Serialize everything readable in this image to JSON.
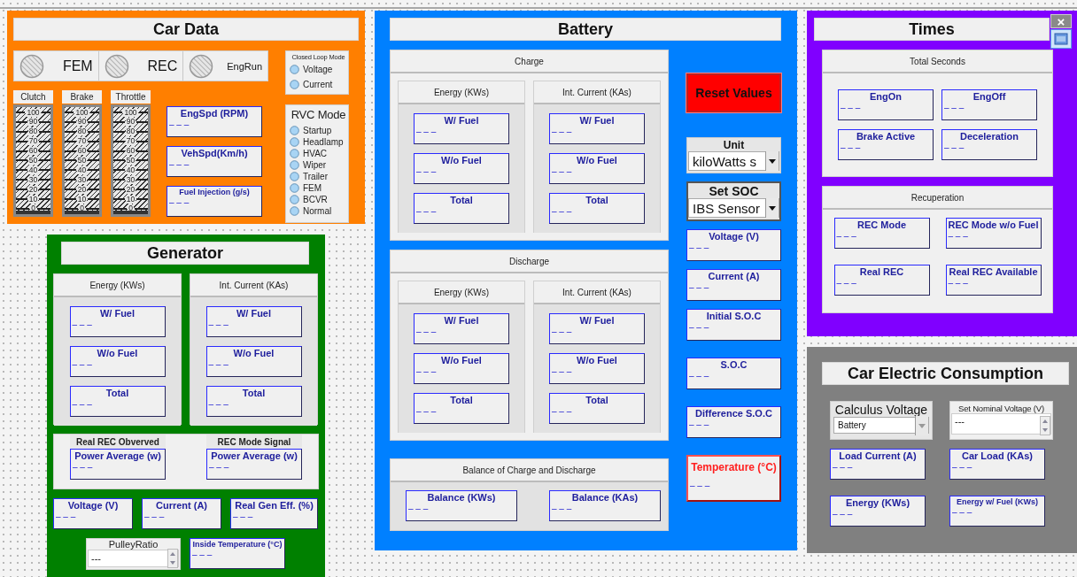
{
  "car_data": {
    "title": "Car Data",
    "leds": [
      {
        "label": "FEM",
        "on": false
      },
      {
        "label": "REC",
        "on": false
      },
      {
        "label": "EngRun",
        "on": false
      }
    ],
    "closed_loop_mode": {
      "title": "Closed Loop Mode",
      "options": [
        {
          "label": "Voltage",
          "selected": false
        },
        {
          "label": "Current",
          "selected": false
        }
      ]
    },
    "sliders": [
      {
        "label": "Clutch",
        "level": 0,
        "scale": [
          "100",
          "90",
          "80",
          "70",
          "60",
          "50",
          "40",
          "30",
          "20",
          "10",
          "0"
        ]
      },
      {
        "label": "Brake",
        "level": 0,
        "scale": [
          "100",
          "90",
          "80",
          "70",
          "60",
          "50",
          "40",
          "30",
          "20",
          "10",
          "0"
        ]
      },
      {
        "label": "Throttle",
        "level": 0,
        "scale": [
          "100",
          "90",
          "80",
          "70",
          "60",
          "50",
          "40",
          "30",
          "20",
          "10",
          "0"
        ]
      }
    ],
    "displays": [
      {
        "title": "EngSpd (RPM)",
        "value": "– – –"
      },
      {
        "title": "VehSpd(Km/h)",
        "value": "– – –"
      },
      {
        "title": "Fuel Injection (g/s)",
        "value": "– – –"
      }
    ],
    "rvc_mode": {
      "title": "RVC Mode",
      "options": [
        {
          "label": "Startup",
          "selected": false
        },
        {
          "label": "Headlamp",
          "selected": false
        },
        {
          "label": "HVAC",
          "selected": false
        },
        {
          "label": "Wiper",
          "selected": false
        },
        {
          "label": "Trailer",
          "selected": false
        },
        {
          "label": "FEM",
          "selected": false
        },
        {
          "label": "BCVR",
          "selected": false
        },
        {
          "label": "Normal",
          "selected": false
        }
      ]
    }
  },
  "generator": {
    "title": "Generator",
    "groups": [
      {
        "header": "Energy (KWs)",
        "displays": [
          {
            "title": "W/ Fuel",
            "value": "– – –"
          },
          {
            "title": "W/o Fuel",
            "value": "– – –"
          },
          {
            "title": "Total",
            "value": "– – –"
          }
        ]
      },
      {
        "header": "Int. Current (KAs)",
        "displays": [
          {
            "title": "W/ Fuel",
            "value": "– – –"
          },
          {
            "title": "W/o Fuel",
            "value": "– – –"
          },
          {
            "title": "Total",
            "value": "– – –"
          }
        ]
      }
    ],
    "rec_signals": [
      {
        "label": "Real REC Obverved",
        "display": {
          "title": "Power Average (w)",
          "value": "– – –"
        }
      },
      {
        "label": "REC Mode Signal",
        "display": {
          "title": "Power Average (w)",
          "value": "– – –"
        }
      }
    ],
    "readings": [
      {
        "title": "Voltage (V)",
        "value": "– – –"
      },
      {
        "title": "Current (A)",
        "value": "– – –"
      },
      {
        "title": "Real Gen Eff. (%)",
        "value": "– – –"
      }
    ],
    "pulley_ratio": {
      "label": "PulleyRatio",
      "value": "---"
    },
    "inside_temperature": {
      "title": "Inside Temperature (°C)",
      "value": "– – –"
    }
  },
  "battery": {
    "title": "Battery",
    "sections": [
      {
        "header": "Charge",
        "groups": [
          {
            "header": "Energy (KWs)",
            "displays": [
              {
                "title": "W/ Fuel",
                "value": "– – –"
              },
              {
                "title": "W/o Fuel",
                "value": "– – –"
              },
              {
                "title": "Total",
                "value": "– – –"
              }
            ]
          },
          {
            "header": "Int. Current (KAs)",
            "displays": [
              {
                "title": "W/ Fuel",
                "value": "– – –"
              },
              {
                "title": "W/o Fuel",
                "value": "– – –"
              },
              {
                "title": "Total",
                "value": "– – –"
              }
            ]
          }
        ]
      },
      {
        "header": "Discharge",
        "groups": [
          {
            "header": "Energy (KWs)",
            "displays": [
              {
                "title": "W/ Fuel",
                "value": "– – –"
              },
              {
                "title": "W/o Fuel",
                "value": "– – –"
              },
              {
                "title": "Total",
                "value": "– – –"
              }
            ]
          },
          {
            "header": "Int. Current (KAs)",
            "displays": [
              {
                "title": "W/ Fuel",
                "value": "– – –"
              },
              {
                "title": "W/o Fuel",
                "value": "– – –"
              },
              {
                "title": "Total",
                "value": "– – –"
              }
            ]
          }
        ]
      }
    ],
    "balance": {
      "header": "Balance of Charge and Discharge",
      "displays": [
        {
          "title": "Balance (KWs)",
          "value": "– – –"
        },
        {
          "title": "Balance (KAs)",
          "value": "– – –"
        }
      ]
    },
    "reset_button": "Reset Values",
    "unit": {
      "label": "Unit",
      "value": "kiloWatts s"
    },
    "set_soc": {
      "label": "Set SOC",
      "value": "IBS Sensor"
    },
    "readings": [
      {
        "title": "Voltage (V)",
        "value": "– – –",
        "alarm": false
      },
      {
        "title": "Current (A)",
        "value": "– – –",
        "alarm": false
      },
      {
        "title": "Initial S.O.C",
        "value": "– – –",
        "alarm": false
      },
      {
        "title": "S.O.C",
        "value": "– – –",
        "alarm": false
      },
      {
        "title": "Difference S.O.C",
        "value": "– – –",
        "alarm": false
      },
      {
        "title": "Temperature (°C)",
        "value": "– – –",
        "alarm": true
      }
    ]
  },
  "times": {
    "title": "Times",
    "close_button": "×",
    "groups": [
      {
        "header": "Total Seconds",
        "displays": [
          {
            "title": "EngOn",
            "value": "– – –"
          },
          {
            "title": "EngOff",
            "value": "– – –"
          },
          {
            "title": "Brake Active",
            "value": "– – –"
          },
          {
            "title": "Deceleration",
            "value": "– – –"
          }
        ]
      },
      {
        "header": "Recuperation",
        "displays": [
          {
            "title": "REC Mode",
            "value": "– – –"
          },
          {
            "title": "REC Mode w/o Fuel",
            "value": "– – –"
          },
          {
            "title": "Real REC",
            "value": "– – –"
          },
          {
            "title": "Real REC Available",
            "value": "– – –"
          }
        ]
      }
    ]
  },
  "car_electric_consumption": {
    "title": "Car Electric Consumption",
    "calculus_voltage": {
      "label": "Calculus Voltage",
      "value": "Battery"
    },
    "nominal_voltage": {
      "label": "Set Nominal Voltage (V)",
      "value": "---"
    },
    "displays": [
      {
        "title": "Load Current (A)",
        "value": "– – –"
      },
      {
        "title": "Car Load (KAs)",
        "value": "– – –"
      },
      {
        "title": "Energy (KWs)",
        "value": "– – –"
      },
      {
        "title": "Energy w/ Fuel (KWs)",
        "value": "– – –"
      }
    ]
  }
}
